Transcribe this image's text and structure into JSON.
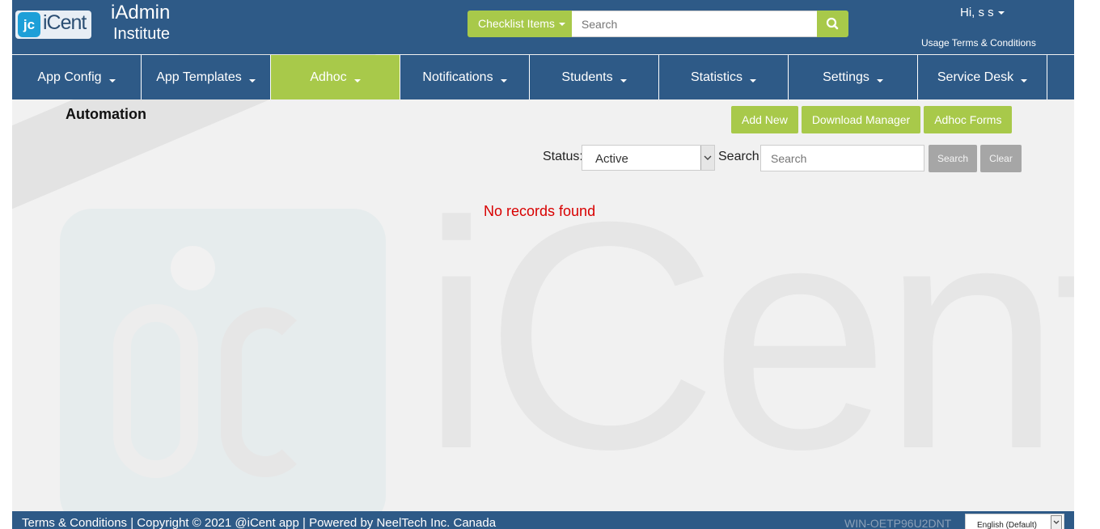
{
  "header": {
    "logo_text": "iCent",
    "logo_mark": "jc",
    "app_title": "iAdmin",
    "app_subtitle": "Institute",
    "checklist_label": "Checklist Items",
    "search_placeholder": "Search",
    "search_icon": "search-icon",
    "greeting": "Hi, s s",
    "terms_link": "Usage Terms & Conditions"
  },
  "nav": {
    "items": [
      {
        "label": "App Config"
      },
      {
        "label": "App Templates"
      },
      {
        "label": "Adhoc"
      },
      {
        "label": "Notifications"
      },
      {
        "label": "Students"
      },
      {
        "label": "Statistics"
      },
      {
        "label": "Settings"
      },
      {
        "label": "Service Desk"
      }
    ],
    "active": "Adhoc"
  },
  "main": {
    "title": "Automation",
    "actions": {
      "add_new": "Add New",
      "download_manager": "Download Manager",
      "adhoc_forms": "Adhoc Forms"
    },
    "filters": {
      "status_label": "Status:",
      "status_value": "Active",
      "search_label": "Search:",
      "search_placeholder": "Search",
      "search_button": "Search",
      "clear_button": "Clear"
    },
    "empty_message": "No records found"
  },
  "watermark": {
    "word": "iCent"
  },
  "footer": {
    "text": "Terms & Conditions | Copyright © 2021 @iCent app | Powered by NeelTech Inc. Canada",
    "server": "WIN-OETP96U2DNT",
    "language": "English (Default)"
  },
  "colors": {
    "primary": "#2e5a87",
    "accent": "#a8c94a",
    "error": "#d80000",
    "muted_button": "#a6a6a6"
  }
}
